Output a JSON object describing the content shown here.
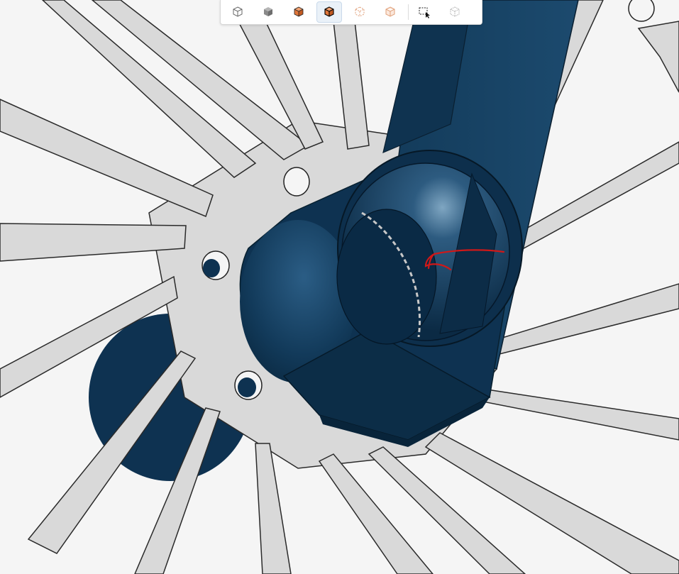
{
  "app": {
    "type": "cad-3d-viewport"
  },
  "toolbar": {
    "buttons": [
      {
        "icon": "wireframe-cube-icon",
        "active": false
      },
      {
        "icon": "shaded-cube-icon",
        "active": false
      },
      {
        "icon": "shaded-edges-cube-icon",
        "active": false
      },
      {
        "icon": "shaded-visible-edges-cube-icon",
        "active": true
      },
      {
        "icon": "hidden-lines-cube-icon",
        "active": false
      },
      {
        "icon": "translucent-cube-icon",
        "active": false
      },
      {
        "icon": "box-select-icon",
        "active": false
      },
      {
        "icon": "section-view-icon",
        "active": false
      }
    ]
  },
  "colors": {
    "background": "#f5f5f5",
    "rotor": "#d9d9d9",
    "part_blue": "#1a4466",
    "part_blue_dark": "#0c2d47",
    "annotation": "#d01818",
    "accent_orange": "#e0763a"
  }
}
